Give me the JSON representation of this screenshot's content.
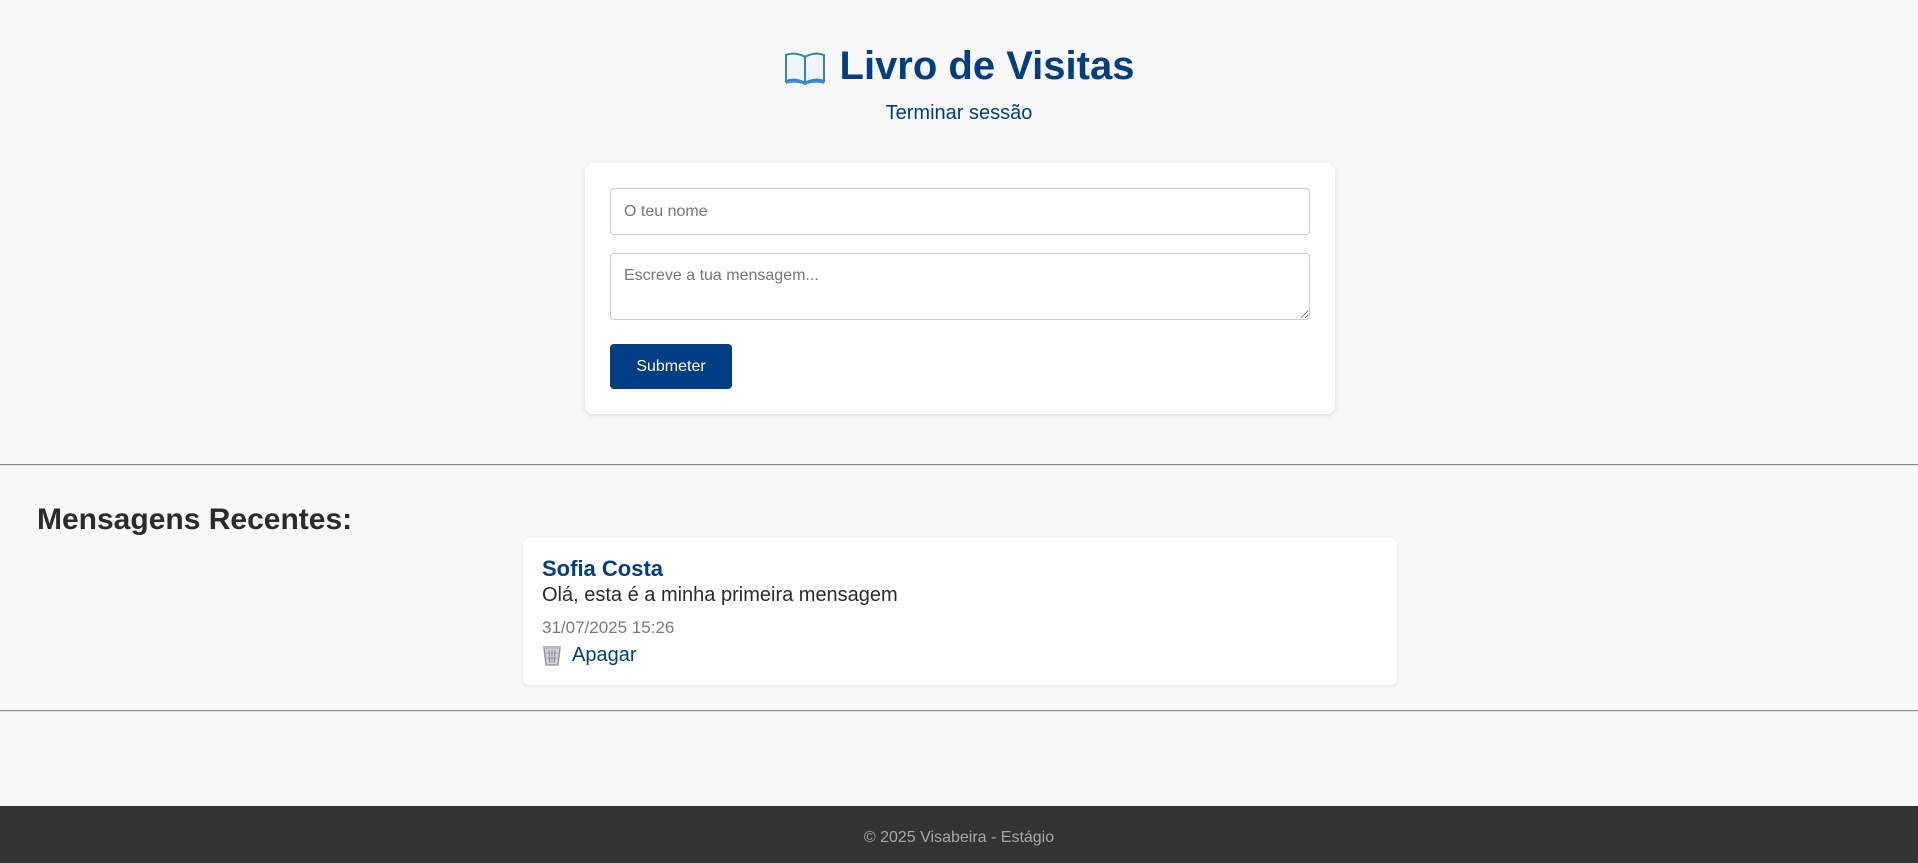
{
  "header": {
    "title": "Livro de Visitas",
    "title_icon": "book-icon",
    "logout_label": "Terminar sessão"
  },
  "form": {
    "name_placeholder": "O teu nome",
    "name_value": "",
    "message_placeholder": "Escreve a tua mensagem...",
    "message_value": "",
    "submit_label": "Submeter"
  },
  "messages_section": {
    "title": "Mensagens Recentes:",
    "items": [
      {
        "author": "Sofia Costa",
        "text": "Olá, esta é a minha primeira mensagem",
        "date": "31/07/2025 15:26",
        "delete_icon": "trash-icon",
        "delete_label": "Apagar"
      }
    ]
  },
  "footer": {
    "text": "© 2025 Visabeira - Estágio"
  },
  "colors": {
    "brand": "#003d82",
    "background": "#f8f8f8",
    "footer_bg": "#333333",
    "footer_text": "#a8a8a8"
  }
}
